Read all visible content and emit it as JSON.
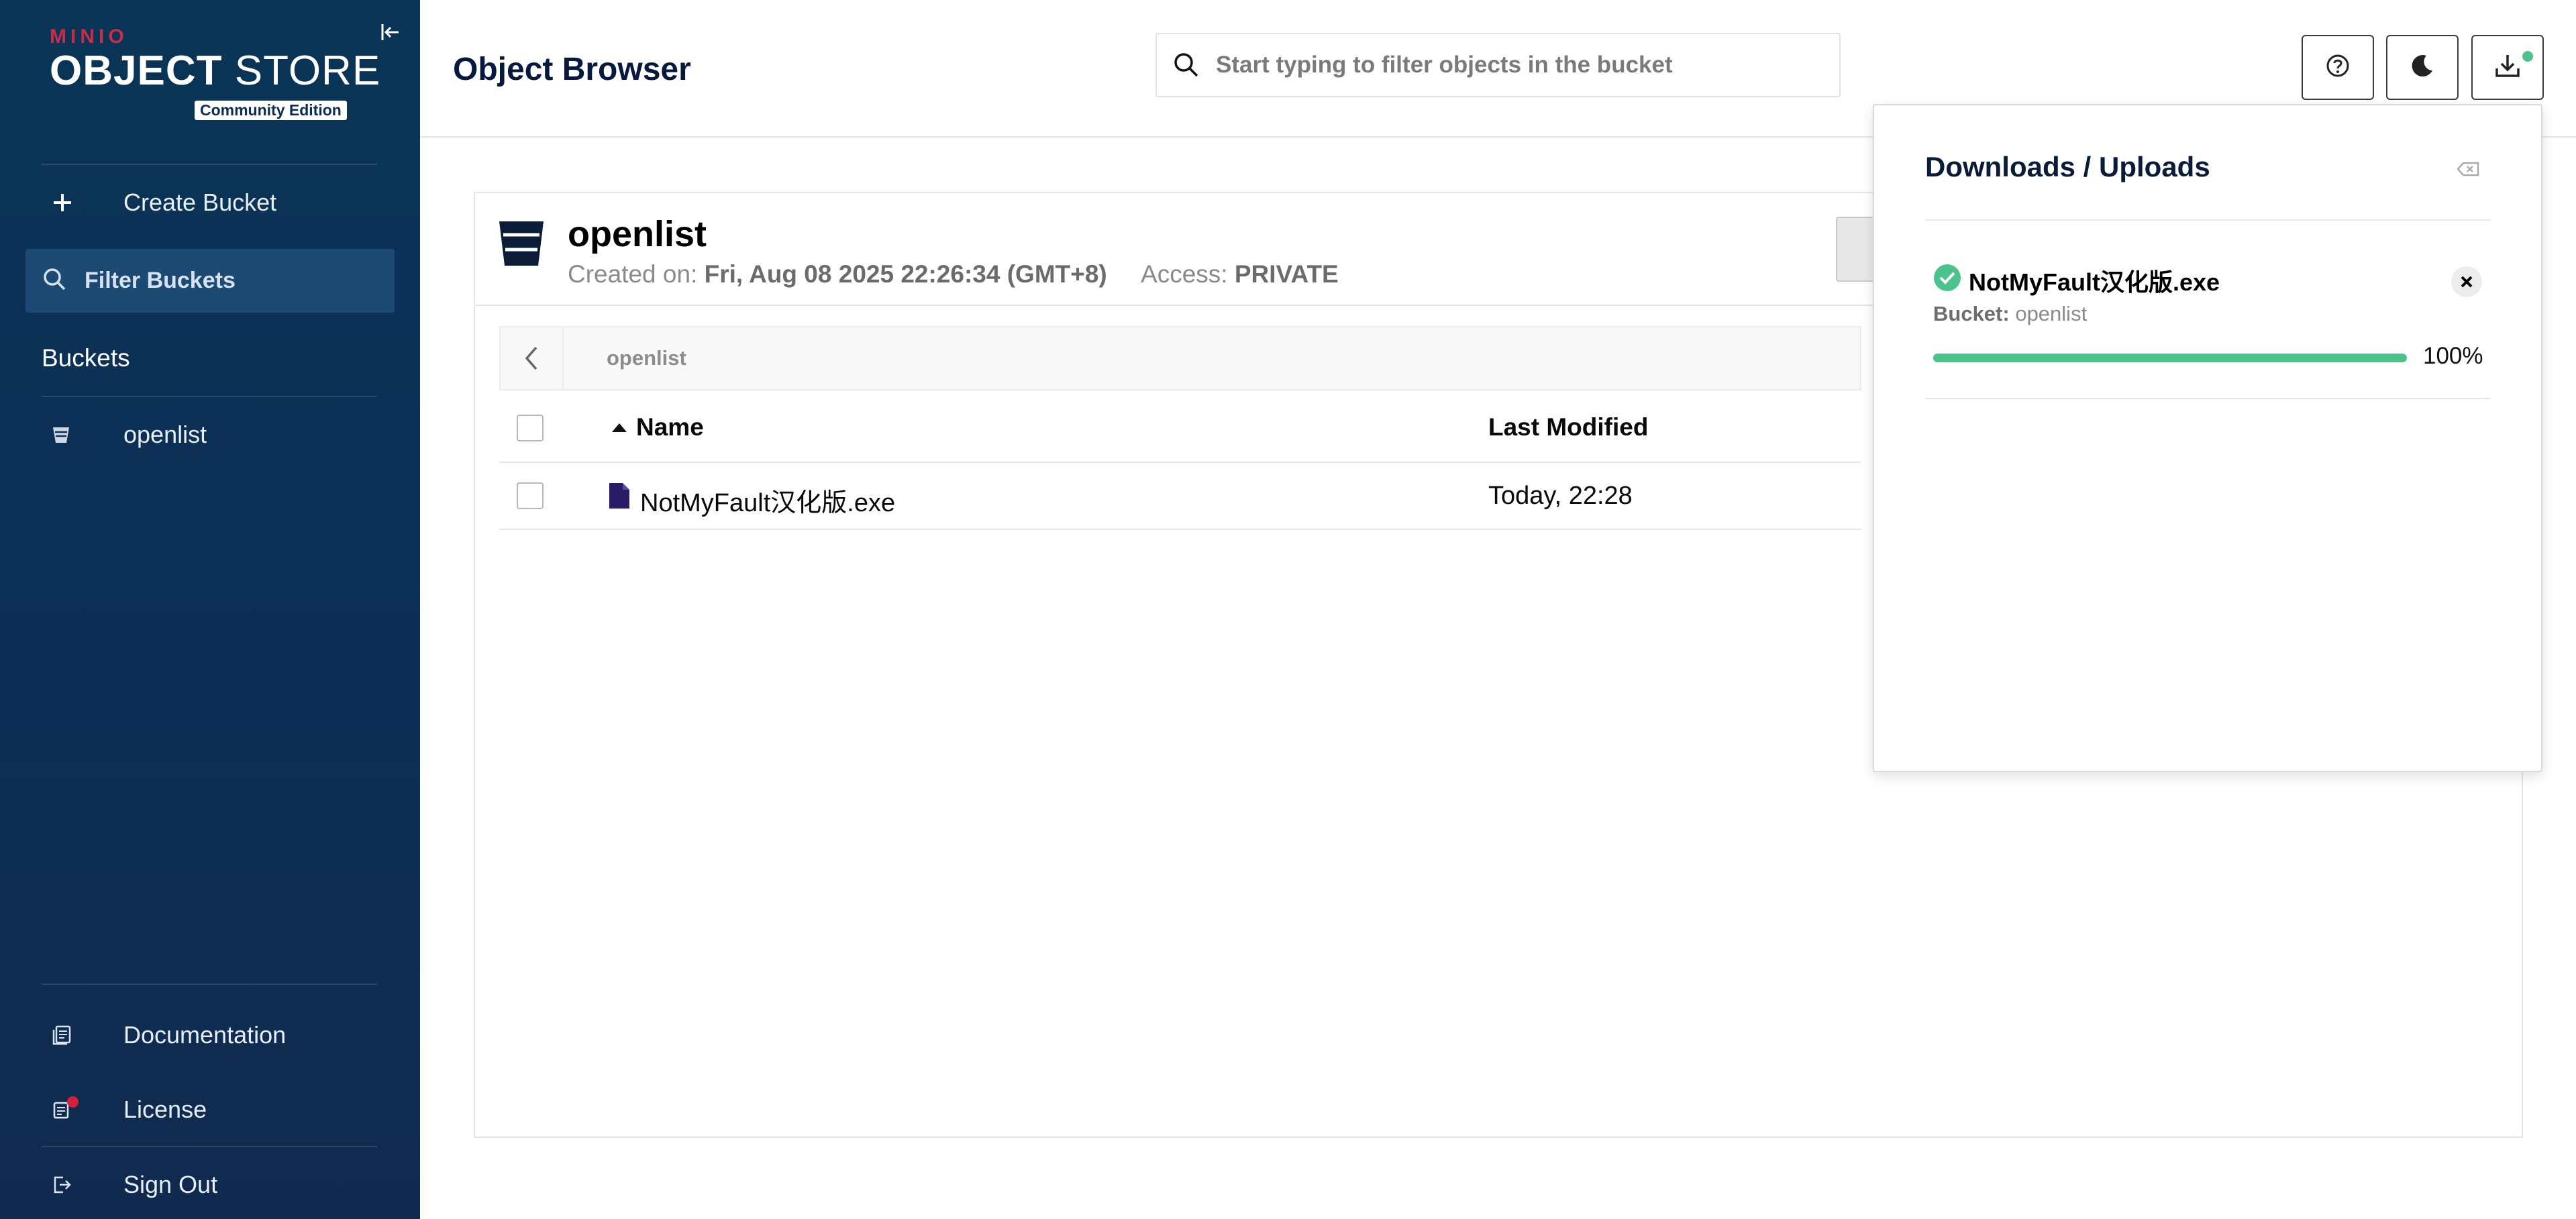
{
  "sidebar": {
    "logo": {
      "vendor": "MINIO",
      "brand_bold": "OBJECT",
      "brand_light": "STORE",
      "edition": "Community Edition"
    },
    "create_bucket_label": "Create Bucket",
    "filter_buckets_label": "Filter Buckets",
    "buckets_title": "Buckets",
    "buckets": [
      {
        "name": "openlist"
      }
    ],
    "documentation_label": "Documentation",
    "license_label": "License",
    "sign_out_label": "Sign Out"
  },
  "header": {
    "title": "Object Browser",
    "search_placeholder": "Start typing to filter objects in the bucket"
  },
  "bucket": {
    "name": "openlist",
    "created_label": "Created on:",
    "created_value": "Fri, Aug 08 2025 22:26:34 (GMT+8)",
    "access_label": "Access:",
    "access_value": "PRIVATE"
  },
  "breadcrumb": {
    "path": "openlist"
  },
  "table": {
    "columns": {
      "name": "Name",
      "last_modified": "Last Modified"
    },
    "rows": [
      {
        "name": "NotMyFault汉化版.exe",
        "last_modified": "Today, 22:28"
      }
    ]
  },
  "downloads": {
    "title": "Downloads / Uploads",
    "items": [
      {
        "file": "NotMyFault汉化版.exe",
        "bucket_label": "Bucket:",
        "bucket": "openlist",
        "progress": 100,
        "progress_text": "100%"
      }
    ]
  },
  "colors": {
    "accent_green": "#4cc38a",
    "sidebar": "#0c2f55",
    "brand_red": "#c72c48"
  }
}
